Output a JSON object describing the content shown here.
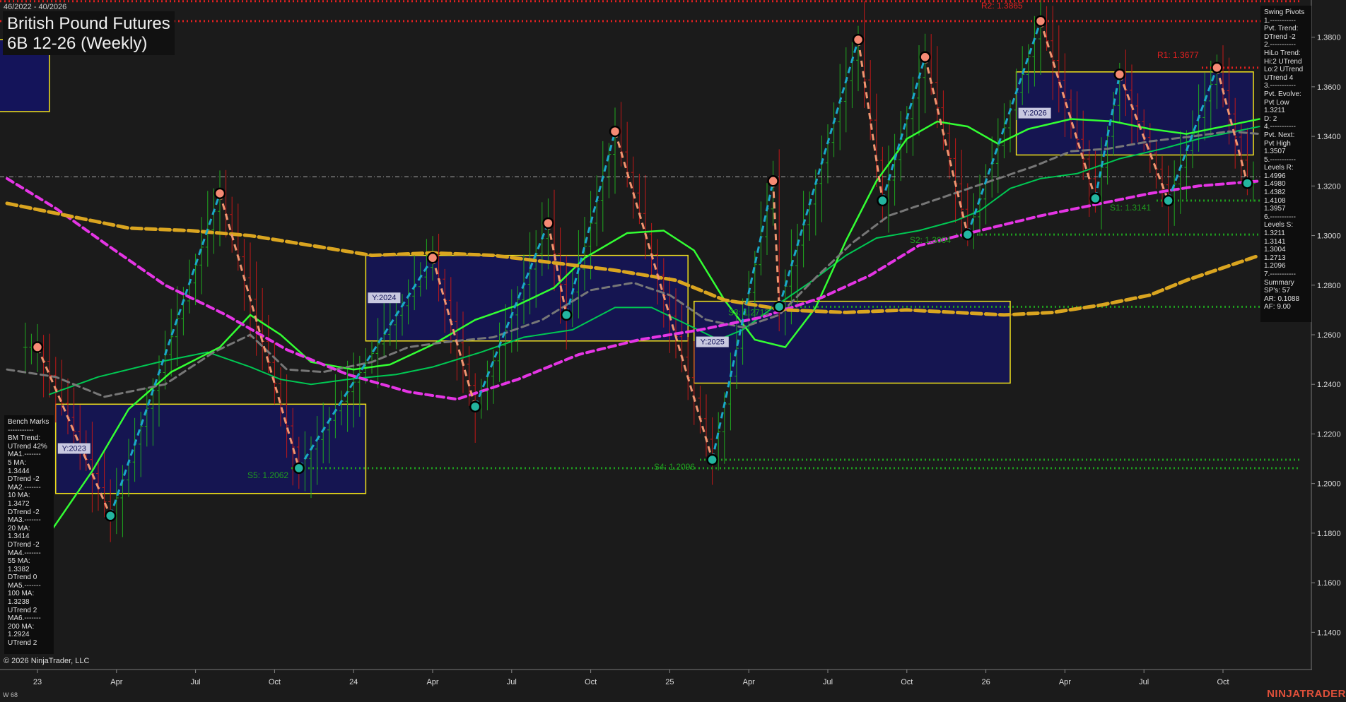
{
  "header": {
    "date_range": "46/2022 - 40/2026",
    "title": "British Pound Futures",
    "subtitle": "6B 12-26 (Weekly)"
  },
  "footer": {
    "copyright": "© 2026 NinjaTrader, LLC",
    "period_label": "W 68",
    "brand": "NINJATRADER"
  },
  "swing_panel": {
    "lines": [
      "Swing Pivots",
      "1.-----------",
      "Pvt. Trend:",
      "DTrend -2",
      "2.-----------",
      "HiLo Trend:",
      "Hi:2 UTrend",
      "Lo:2 UTrend",
      "UTrend 4",
      "3.-----------",
      "Pvt. Evolve:",
      "Pvt Low",
      "1.3211",
      "D: 2",
      "4.-----------",
      "Pvt. Next:",
      "Pvt High",
      "1.3507",
      "5.-----------",
      "Levels R:",
      "1.4996",
      "1.4980",
      "1.4382",
      "1.4108",
      "1.3957",
      "6.-----------",
      "Levels S:",
      "1.3211",
      "1.3141",
      "1.3004",
      "1.2713",
      "1.2096",
      "7.-----------",
      "Summary",
      "SP's: 57",
      "AR: 0.1088",
      "AF: 9.00"
    ]
  },
  "bench_panel": {
    "lines": [
      "Bench Marks",
      "-----------",
      "BM Trend:",
      "UTrend 42%",
      "MA1.-------",
      "5 MA:",
      "1.3444",
      "DTrend -2",
      "MA2.-------",
      "10 MA:",
      "1.3472",
      "DTrend -2",
      "MA3.-------",
      "20 MA:",
      "1.3414",
      "DTrend -2",
      "MA4.-------",
      "55 MA:",
      "1.3382",
      "DTrend 0",
      "MA5.-------",
      "100 MA:",
      "1.3238",
      "UTrend 2",
      "MA6.-------",
      "200 MA:",
      "1.2924",
      "UTrend 2"
    ]
  },
  "chart_data": {
    "type": "line",
    "ylim": [
      1.125,
      1.395
    ],
    "y_ticks": [
      "1.3800",
      "1.3600",
      "1.3400",
      "1.3200",
      "1.3000",
      "1.2800",
      "1.2600",
      "1.2400",
      "1.2200",
      "1.2000",
      "1.1800",
      "1.1600",
      "1.1400"
    ],
    "x_ticks": [
      "23",
      "Apr",
      "Jul",
      "Oct",
      "24",
      "Apr",
      "Jul",
      "Oct",
      "25",
      "Apr",
      "Jul",
      "Oct",
      "26",
      "Apr",
      "Jul",
      "Oct"
    ],
    "x_tick_weeks": [
      5,
      18,
      31,
      44,
      57,
      70,
      83,
      96,
      109,
      122,
      135,
      148,
      161,
      174,
      187,
      200
    ],
    "price_scale_current": 1.3237,
    "levels": [
      {
        "label": "R2: 1.3865",
        "value": 1.3865,
        "kind": "resistance"
      },
      {
        "label": "R1: 1.3677",
        "value": 1.3677,
        "kind": "resistance"
      },
      {
        "label": "S1: 1.3141",
        "value": 1.3141,
        "kind": "support"
      },
      {
        "label": "S2: 1.3004",
        "value": 1.3004,
        "kind": "support"
      },
      {
        "label": "S3: 1.2713",
        "value": 1.2713,
        "kind": "support"
      },
      {
        "label": "S4: 1.2096",
        "value": 1.2096,
        "kind": "support"
      },
      {
        "label": "S5: 1.2062",
        "value": 1.2062,
        "kind": "support"
      }
    ],
    "extra_resistance_lines": [
      1.3945,
      1.3865
    ],
    "year_boxes": [
      {
        "label": "Y:2023",
        "start": 8,
        "end": 59,
        "high": 1.232,
        "low": 1.196
      },
      {
        "label": "Y:2024",
        "start": 59,
        "end": 112,
        "high": 1.292,
        "low": 1.2575
      },
      {
        "label": "Y:2025",
        "start": 113,
        "end": 165,
        "high": 1.2735,
        "low": 1.2405
      },
      {
        "label": "Y:2026",
        "start": 166,
        "end": 205,
        "high": 1.366,
        "low": 1.3325
      }
    ],
    "pivots": [
      {
        "week": 5,
        "price": 1.255,
        "type": "high"
      },
      {
        "week": 17,
        "price": 1.187,
        "type": "low"
      },
      {
        "week": 35,
        "price": 1.317,
        "type": "high"
      },
      {
        "week": 48,
        "price": 1.2062,
        "type": "low"
      },
      {
        "week": 70,
        "price": 1.291,
        "type": "high"
      },
      {
        "week": 77,
        "price": 1.231,
        "type": "low"
      },
      {
        "week": 89,
        "price": 1.305,
        "type": "high"
      },
      {
        "week": 92,
        "price": 1.268,
        "type": "low"
      },
      {
        "week": 100,
        "price": 1.342,
        "type": "high"
      },
      {
        "week": 116,
        "price": 1.2096,
        "type": "low"
      },
      {
        "week": 126,
        "price": 1.322,
        "type": "high"
      },
      {
        "week": 127,
        "price": 1.2713,
        "type": "low"
      },
      {
        "week": 140,
        "price": 1.379,
        "type": "high"
      },
      {
        "week": 144,
        "price": 1.3141,
        "type": "low"
      },
      {
        "week": 151,
        "price": 1.372,
        "type": "high"
      },
      {
        "week": 158,
        "price": 1.3004,
        "type": "low"
      },
      {
        "week": 170,
        "price": 1.3865,
        "type": "high"
      },
      {
        "week": 179,
        "price": 1.315,
        "type": "low"
      },
      {
        "week": 183,
        "price": 1.365,
        "type": "high"
      },
      {
        "week": 191,
        "price": 1.3141,
        "type": "low"
      },
      {
        "week": 199,
        "price": 1.3677,
        "type": "high"
      },
      {
        "week": 204,
        "price": 1.3211,
        "type": "low"
      }
    ],
    "series": [
      {
        "name": "5 MA",
        "color": "#00c853",
        "dash": "solid",
        "points": [
          [
            7,
            1.236
          ],
          [
            15,
            1.243
          ],
          [
            25,
            1.249
          ],
          [
            33,
            1.253
          ],
          [
            40,
            1.247
          ],
          [
            45,
            1.242
          ],
          [
            50,
            1.24
          ],
          [
            56,
            1.242
          ],
          [
            64,
            1.244
          ],
          [
            70,
            1.247
          ],
          [
            78,
            1.253
          ],
          [
            85,
            1.259
          ],
          [
            93,
            1.262
          ],
          [
            100,
            1.271
          ],
          [
            106,
            1.271
          ],
          [
            112,
            1.264
          ],
          [
            117,
            1.258
          ],
          [
            121,
            1.262
          ],
          [
            126,
            1.271
          ],
          [
            132,
            1.281
          ],
          [
            138,
            1.292
          ],
          [
            143,
            1.299
          ],
          [
            150,
            1.302
          ],
          [
            156,
            1.306
          ],
          [
            160,
            1.31
          ],
          [
            165,
            1.319
          ],
          [
            170,
            1.323
          ],
          [
            176,
            1.325
          ],
          [
            183,
            1.331
          ],
          [
            190,
            1.335
          ],
          [
            196,
            1.339
          ],
          [
            202,
            1.342
          ],
          [
            206,
            1.344
          ]
        ]
      },
      {
        "name": "10 MA",
        "color": "#33ff33",
        "dash": "solid",
        "points": [
          [
            7,
            1.18
          ],
          [
            14,
            1.205
          ],
          [
            20,
            1.23
          ],
          [
            27,
            1.245
          ],
          [
            35,
            1.255
          ],
          [
            40,
            1.268
          ],
          [
            45,
            1.26
          ],
          [
            50,
            1.249
          ],
          [
            57,
            1.246
          ],
          [
            63,
            1.248
          ],
          [
            70,
            1.256
          ],
          [
            77,
            1.266
          ],
          [
            84,
            1.272
          ],
          [
            90,
            1.279
          ],
          [
            95,
            1.291
          ],
          [
            102,
            1.301
          ],
          [
            108,
            1.302
          ],
          [
            113,
            1.294
          ],
          [
            118,
            1.274
          ],
          [
            123,
            1.258
          ],
          [
            128,
            1.255
          ],
          [
            133,
            1.271
          ],
          [
            138,
            1.298
          ],
          [
            143,
            1.322
          ],
          [
            148,
            1.339
          ],
          [
            153,
            1.346
          ],
          [
            158,
            1.344
          ],
          [
            163,
            1.337
          ],
          [
            168,
            1.343
          ],
          [
            175,
            1.347
          ],
          [
            182,
            1.346
          ],
          [
            188,
            1.343
          ],
          [
            194,
            1.341
          ],
          [
            200,
            1.344
          ],
          [
            206,
            1.347
          ]
        ]
      },
      {
        "name": "20 MA",
        "color": "#777777",
        "dash": "dashed",
        "points": [
          [
            0,
            1.246
          ],
          [
            8,
            1.243
          ],
          [
            16,
            1.235
          ],
          [
            26,
            1.24
          ],
          [
            34,
            1.253
          ],
          [
            40,
            1.26
          ],
          [
            46,
            1.246
          ],
          [
            52,
            1.245
          ],
          [
            60,
            1.249
          ],
          [
            66,
            1.255
          ],
          [
            72,
            1.257
          ],
          [
            80,
            1.259
          ],
          [
            88,
            1.266
          ],
          [
            96,
            1.278
          ],
          [
            103,
            1.281
          ],
          [
            109,
            1.276
          ],
          [
            115,
            1.266
          ],
          [
            121,
            1.263
          ],
          [
            127,
            1.268
          ],
          [
            133,
            1.283
          ],
          [
            139,
            1.297
          ],
          [
            145,
            1.308
          ],
          [
            151,
            1.313
          ],
          [
            157,
            1.318
          ],
          [
            163,
            1.323
          ],
          [
            169,
            1.328
          ],
          [
            175,
            1.334
          ],
          [
            181,
            1.335
          ],
          [
            188,
            1.338
          ],
          [
            195,
            1.34
          ],
          [
            201,
            1.342
          ],
          [
            206,
            1.341
          ]
        ]
      },
      {
        "name": "100 MA",
        "color": "#e535e5",
        "dash": "dashed",
        "points": [
          [
            0,
            1.323
          ],
          [
            8,
            1.311
          ],
          [
            16,
            1.297
          ],
          [
            26,
            1.28
          ],
          [
            36,
            1.268
          ],
          [
            46,
            1.254
          ],
          [
            56,
            1.244
          ],
          [
            66,
            1.237
          ],
          [
            74,
            1.234
          ],
          [
            84,
            1.242
          ],
          [
            94,
            1.252
          ],
          [
            104,
            1.258
          ],
          [
            114,
            1.262
          ],
          [
            124,
            1.267
          ],
          [
            134,
            1.275
          ],
          [
            142,
            1.284
          ],
          [
            150,
            1.296
          ],
          [
            160,
            1.302
          ],
          [
            170,
            1.308
          ],
          [
            180,
            1.313
          ],
          [
            188,
            1.317
          ],
          [
            196,
            1.32
          ],
          [
            206,
            1.322
          ]
        ]
      },
      {
        "name": "200 MA",
        "color": "#daa520",
        "dash": "dashed",
        "points": [
          [
            0,
            1.313
          ],
          [
            10,
            1.308
          ],
          [
            20,
            1.303
          ],
          [
            30,
            1.302
          ],
          [
            40,
            1.3
          ],
          [
            50,
            1.296
          ],
          [
            60,
            1.292
          ],
          [
            70,
            1.293
          ],
          [
            80,
            1.292
          ],
          [
            90,
            1.289
          ],
          [
            100,
            1.286
          ],
          [
            110,
            1.282
          ],
          [
            118,
            1.274
          ],
          [
            128,
            1.27
          ],
          [
            138,
            1.269
          ],
          [
            148,
            1.27
          ],
          [
            156,
            1.269
          ],
          [
            164,
            1.268
          ],
          [
            172,
            1.269
          ],
          [
            180,
            1.272
          ],
          [
            188,
            1.276
          ],
          [
            194,
            1.282
          ],
          [
            200,
            1.287
          ],
          [
            206,
            1.292
          ]
        ]
      }
    ]
  }
}
